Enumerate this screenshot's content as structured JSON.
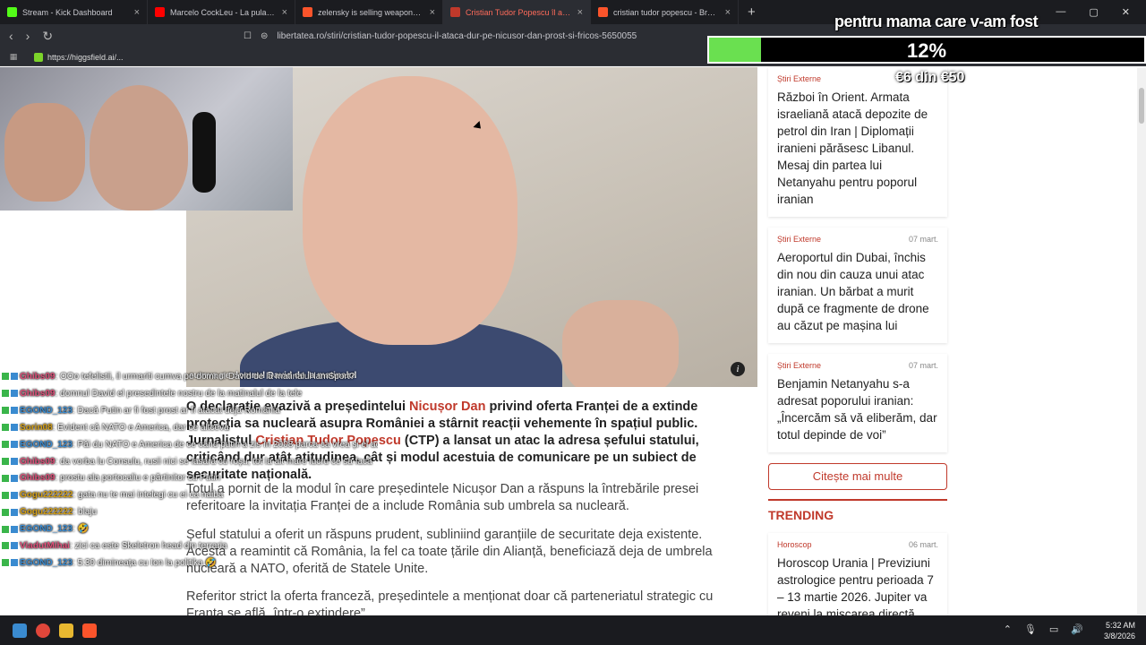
{
  "browser": {
    "tabs": [
      {
        "label": "Stream - Kick Dashboard",
        "color": "#53fc18"
      },
      {
        "label": "Marcelo CockLeu - La pula goală (fe",
        "color": "#ff0000"
      },
      {
        "label": "zelensky is selling weapons - Brave S",
        "color": "#fb542b"
      },
      {
        "label": "Cristian Tudor Popescu îl atacă d",
        "color": "#c0392b",
        "active": true
      },
      {
        "label": "cristian tudor popescu - Brave Search",
        "color": "#fb542b"
      }
    ],
    "url": "libertatea.ro/stiri/cristian-tudor-popescu-il-ataca-dur-pe-nicusor-dan-prost-si-fricos-5650055",
    "bookmark": "https://higgsfield.ai/..."
  },
  "stream_overlay": {
    "goal_title": "pentru mama care v-am fost",
    "goal_percent_text": "12%",
    "goal_fraction": 0.12,
    "goal_amount": "€6 din €50"
  },
  "article": {
    "image_caption": "cumva pe domnul David de la matinalul",
    "lead_parts": [
      "O declarație evazivă a președintelui ",
      "Nicușor Dan",
      " privind oferta Franței de a extinde protecția sa nucleară asupra României a stârnit reacții vehemente în spațiul public. Jurnalistul ",
      "Cristian Tudor Popescu",
      " (CTP) a lansat un atac la adresa șefului statului, criticând dur atât atitudinea, cât și modul acestuia de comunicare pe un subiect de securitate națională."
    ],
    "paragraphs": [
      "Totul a pornit de la modul în care președintele Nicușor Dan a răspuns la întrebările presei referitoare la invitația Franței de a include România sub umbrela sa nucleară.",
      "Șeful statului a oferit un răspuns prudent, subliniind garanțiile de securitate deja existente. Acesta a reamintit că România, la fel ca toate țările din Alianță, beneficiază deja de umbrela nucleară a NATO, oferită de Statele Unite.",
      "Referitor strict la oferta franceză, președintele a menționat doar că parteneriatul strategic cu Franța se află „într-o extindere”"
    ]
  },
  "sidebar": {
    "cards": [
      {
        "category": "Știri Externe",
        "date": "",
        "title": "Război în Orient. Armata israeliană atacă depozite de petrol din Iran | Diplomații iranieni părăsesc Libanul. Mesaj din partea lui Netanyahu pentru poporul iranian"
      },
      {
        "category": "Știri Externe",
        "date": "07 mart.",
        "title": "Aeroportul din Dubai, închis din nou din cauza unui atac iranian. Un bărbat a murit după ce fragmente de drone au căzut pe mașina lui"
      },
      {
        "category": "Știri Externe",
        "date": "07 mart.",
        "title": "Benjamin Netanyahu s-a adresat poporului iranian: „Încercăm să vă eliberăm, dar totul depinde de voi”"
      }
    ],
    "more_button": "Citește mai multe",
    "trending_label": "TRENDING",
    "trending_card": {
      "category": "Horoscop",
      "date": "06 mart.",
      "title": "Horoscop Urania | Previziuni astrologice pentru perioada 7 – 13 martie 2026. Jupiter va reveni la mișcarea directă"
    }
  },
  "chat": [
    {
      "user": "Ghibs09",
      "color": "#e0507a",
      "text": ": OOo tefelistii, il urmariti cumva pe domnul David de la matinalul lamSport?"
    },
    {
      "user": "Ghibs09",
      "color": "#e0507a",
      "text": ": domnul David el presedintele nostru de la matinalul de la tele"
    },
    {
      "user": "EGOND_123",
      "color": "#3a8bd0",
      "text": ": Dacă Putin ar fi fost prost ar fi atacat deja România"
    },
    {
      "user": "Sorin08",
      "color": "#d4a017",
      "text": ": Evident că NATO e America, dar ce altceva"
    },
    {
      "user": "EGOND_123",
      "color": "#3a8bd0",
      "text": ": Păi du NATO e America de ce când putin a zis în 2008 parca ca vrea și el acolo de ce nu a fost primit?"
    },
    {
      "user": "Ghibs09",
      "color": "#e0507a",
      "text": ": da vorba lu Consulu, rusii nici se lasară cu roșu, tot la alt mare lucru ce sa facă"
    },
    {
      "user": "Ghibs09",
      "color": "#e0507a",
      "text": ": prostu ala portocaliu e părtinitor cu Putin"
    },
    {
      "user": "Gogu222222",
      "color": "#d4a017",
      "text": ": gata nu te mai intelegi cu ei ca naiba"
    },
    {
      "user": "Gogu222222",
      "color": "#d4a017",
      "text": ": blaju"
    },
    {
      "user": "EGOND_123",
      "color": "#3a8bd0",
      "text": ": 🤣"
    },
    {
      "user": "ViadutMihai",
      "color": "#e0507a",
      "text": ": zici ca este Skeletron head din terraria"
    },
    {
      "user": "EGOND_123",
      "color": "#3a8bd0",
      "text": ": 5:30 dimineața cu Ion la politika 🤣"
    }
  ],
  "taskbar": {
    "time": "5:32 AM",
    "date": "3/8/2026"
  }
}
